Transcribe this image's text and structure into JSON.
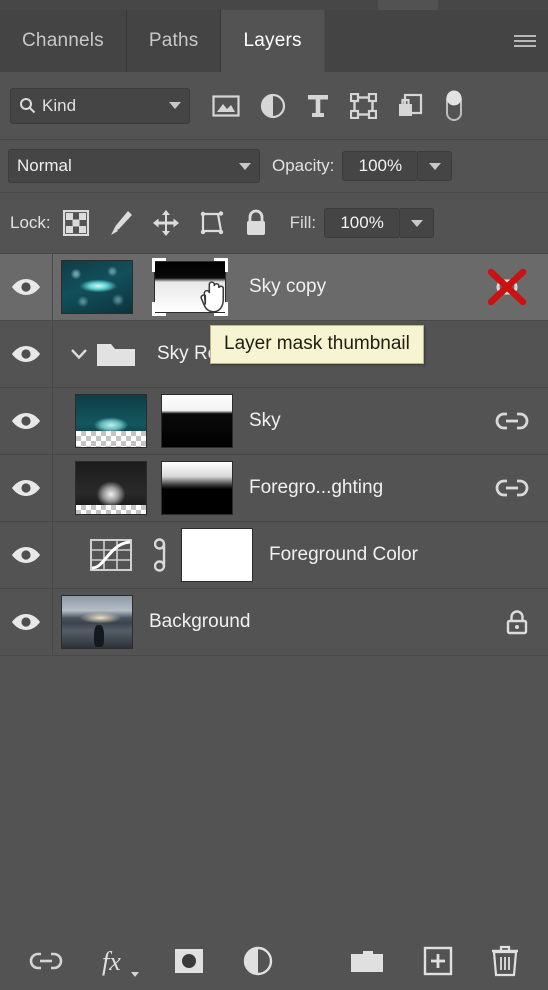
{
  "panel": {
    "tabs": [
      {
        "label": "Channels",
        "active": false
      },
      {
        "label": "Paths",
        "active": false
      },
      {
        "label": "Layers",
        "active": true
      }
    ],
    "menu_icon": "hamburger-menu-icon"
  },
  "filter": {
    "search_icon": "search-icon",
    "kind_label": "Kind",
    "dropdown_icon": "chevron-down-icon",
    "icons": [
      "pixel-layer-filter-icon",
      "adjustment-layer-filter-icon",
      "type-layer-filter-icon",
      "shape-layer-filter-icon",
      "smart-object-filter-icon",
      "filter-toggle-switch"
    ]
  },
  "blend": {
    "mode": "Normal",
    "opacity_label": "Opacity:",
    "opacity_value": "100%"
  },
  "lock": {
    "label": "Lock:",
    "icons": [
      "lock-transparent-pixels-icon",
      "lock-image-pixels-icon",
      "lock-position-icon",
      "lock-artboard-nesting-icon",
      "lock-all-icon"
    ],
    "fill_label": "Fill:",
    "fill_value": "100%"
  },
  "layers": [
    {
      "name": "Sky copy",
      "selected": true,
      "visible": true,
      "visibility_icon": "eye-icon",
      "thumbnail": "galaxy-thumbnail",
      "mask": "layer-mask-thumbnail",
      "mask_active": true,
      "right_icon": "broken-link-icon",
      "type": "pixel"
    },
    {
      "name": "Sky Re",
      "selected": false,
      "visible": true,
      "visibility_icon": "eye-icon",
      "expand_icon": "chevron-down-icon",
      "folder_icon": "folder-icon",
      "type": "group"
    },
    {
      "name": "Sky",
      "selected": false,
      "visible": true,
      "visibility_icon": "eye-icon",
      "thumbnail": "sky-thumbnail",
      "mask": "layer-mask-thumbnail",
      "right_icon": "link-icon",
      "type": "pixel"
    },
    {
      "name": "Foregro...ghting",
      "selected": false,
      "visible": true,
      "visibility_icon": "eye-icon",
      "thumbnail": "foreground-lighting-thumbnail",
      "mask": "layer-mask-thumbnail",
      "right_icon": "link-icon",
      "type": "pixel"
    },
    {
      "name": "Foreground Color",
      "selected": false,
      "visible": true,
      "visibility_icon": "eye-icon",
      "adjustment_icon": "curves-adjustment-icon",
      "link_icon": "mask-link-icon",
      "mask": "white-mask-thumbnail",
      "type": "adjustment"
    },
    {
      "name": "Background",
      "selected": false,
      "visible": true,
      "visibility_icon": "eye-icon",
      "thumbnail": "background-photo-thumbnail",
      "right_icon": "lock-icon",
      "type": "background"
    }
  ],
  "tooltip": {
    "text": "Layer mask thumbnail",
    "background": "#f7f4d2",
    "text_color": "#1f1f12"
  },
  "bottom_toolbar": [
    "link-layers-icon",
    "layer-style-fx-icon",
    "add-layer-mask-icon",
    "new-adjustment-layer-icon",
    "new-group-icon",
    "new-layer-icon",
    "delete-layer-icon"
  ],
  "colors": {
    "panel_bg": "#535353",
    "tab_bg": "#444444",
    "selected_row": "#6a6a6a",
    "accent_red": "#cc2222",
    "text": "#f0f0f0"
  }
}
